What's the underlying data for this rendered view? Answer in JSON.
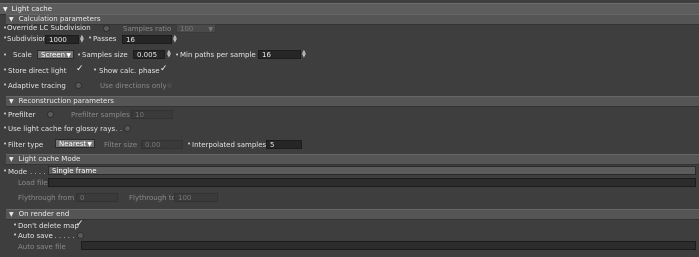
{
  "panel": {
    "title": "Light cache"
  },
  "calc": {
    "title": "Calculation parameters",
    "override_lc_label": "Override LC Subdivision",
    "samples_ratio_label": "Samples ratio",
    "samples_ratio_value": "100",
    "subdivision_label": "Subdivision",
    "subdivision_value": "1000",
    "passes_label": "Passes",
    "passes_value": "16",
    "scale_label": "Scale",
    "scale_value": "Screen",
    "samples_size_label": "Samples size",
    "samples_size_value": "0.005",
    "min_paths_label": "Min paths per sample",
    "min_paths_value": "16",
    "store_direct_label": "Store direct light",
    "show_calc_label": "Show calc. phase",
    "adaptive_label": "Adaptive tracing",
    "use_dirs_label": "Use directions only"
  },
  "recon": {
    "title": "Reconstruction parameters",
    "prefilter_label": "Prefilter",
    "prefilter_samples_label": "Prefilter samples",
    "prefilter_samples_value": "10",
    "glossy_label": "Use light cache for glossy rays",
    "filter_type_label": "Filter type",
    "filter_type_value": "Nearest",
    "filter_size_label": "Filter size",
    "filter_size_value": "0.00",
    "interp_label": "Interpolated samples",
    "interp_value": "5"
  },
  "mode": {
    "title": "Light cache Mode",
    "mode_label": "Mode",
    "mode_value": "Single frame",
    "load_file_label": "Load file",
    "flythrough_from_label": "Flythrough from",
    "flythrough_from_value": "0",
    "flythrough_to_label": "Flythrough to",
    "flythrough_to_value": "100"
  },
  "render_end": {
    "title": "On render end",
    "dont_delete_label": "Don't delete map",
    "auto_save_label": "Auto save",
    "auto_save_file_label": "Auto save file"
  },
  "colors": {
    "background": "#3e3e3e",
    "header": "#5d5d5d",
    "field": "#262626",
    "combo": "#747474"
  }
}
